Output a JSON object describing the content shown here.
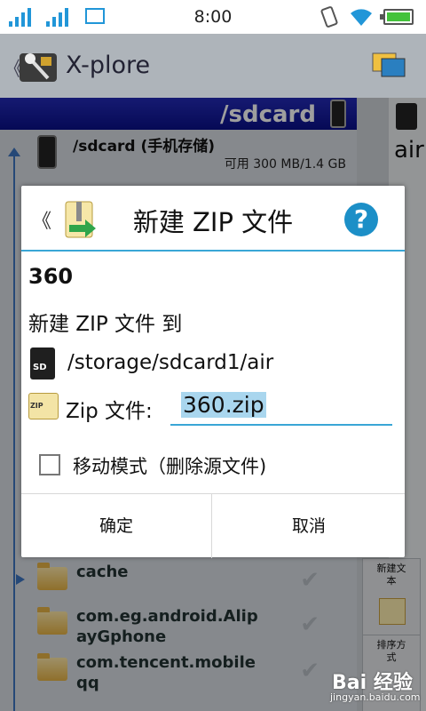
{
  "status_bar": {
    "time": "8:00",
    "icons": [
      "signal-icon",
      "signal-icon",
      "image-icon",
      "rotation-lock-icon",
      "wifi-icon",
      "battery-icon"
    ]
  },
  "app_bar": {
    "back_glyph": "《",
    "title": "X-plore"
  },
  "pane": {
    "path": "/sdcard",
    "root_name": "/sdcard (手机存储)",
    "root_free": "可用 300 MB/1.4 GB",
    "folders": [
      {
        "name": "cache"
      },
      {
        "name": "com.eg.android.Alip\nayGphone"
      },
      {
        "name": "com.tencent.mobile\nqq"
      }
    ]
  },
  "side_pane": {
    "tab_label": "air",
    "buttons": [
      {
        "label": "新建文\n本"
      },
      {
        "label": "排序方\n式"
      }
    ]
  },
  "dialog": {
    "back_glyph": "《",
    "title": "新建 ZIP 文件",
    "help_glyph": "?",
    "source_name": "360",
    "to_label": "新建 ZIP 文件 到",
    "sd_text": "SD",
    "destination": "/storage/sdcard1/air",
    "zip_icon_text": "ZIP",
    "zip_label": "Zip 文件:",
    "zip_value": "360.zip",
    "move_mode_label": "移动模式（删除源文件)",
    "move_mode_checked": false,
    "ok_label": "确定",
    "cancel_label": "取消"
  },
  "watermark": {
    "brand": "Bai 经验",
    "url": "jingyan.baidu.com"
  },
  "colors": {
    "accent": "#3aa6d6",
    "header_blue": "#0a108a",
    "help_blue": "#1c8fc7"
  }
}
